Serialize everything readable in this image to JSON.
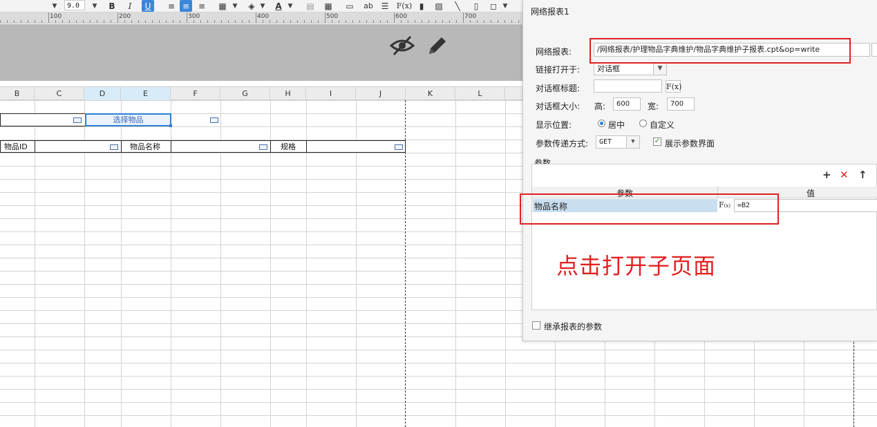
{
  "toolbar": {
    "font_size": "9.0",
    "bold": "B",
    "italic": "I",
    "underline": "U",
    "ab": "ab",
    "fx": "F(x)"
  },
  "ruler": {
    "labels": [
      "100",
      "200",
      "300",
      "400",
      "500",
      "600",
      "700"
    ]
  },
  "columns": [
    "B",
    "C",
    "D",
    "E",
    "F",
    "G",
    "H",
    "I",
    "J",
    "K",
    "L"
  ],
  "sheet": {
    "select_button_label": "选择物品",
    "cells": {
      "item_id_label": "物品ID",
      "item_name_label": "物品名称",
      "spec_label": "规格"
    }
  },
  "dialog": {
    "title": "网络报表1",
    "report_label": "网络报表:",
    "report_path": "/网络报表/护理物品字典维护/物品字典维护子报表.cpt&op=write",
    "link_open_label": "链接打开于:",
    "link_open_value": "对话框",
    "dialog_title_label": "对话框标题:",
    "dialog_title_value": "",
    "fx_label": "F(x)",
    "dialog_size_label": "对话框大小:",
    "height_label": "高:",
    "height_value": "600",
    "width_label": "宽:",
    "width_value": "700",
    "position_label": "显示位置:",
    "position_center": "居中",
    "position_custom": "自定义",
    "position_selected": "居中",
    "param_method_label": "参数传递方式:",
    "param_method_value": "GET",
    "show_params_label": "展示参数界面",
    "show_params_checked": true,
    "params_section_label": "参数",
    "table": {
      "col_param": "参数",
      "col_value": "值",
      "rows": [
        {
          "param": "物品名称",
          "value": "=B2"
        }
      ]
    },
    "inherit_label": "继承报表的参数",
    "inherit_checked": false
  },
  "annotation": "点击打开子页面",
  "colors": {
    "annotation_red": "#e32020",
    "selection_blue": "#2f7fd4",
    "banner_gray": "#b8b8b8"
  }
}
